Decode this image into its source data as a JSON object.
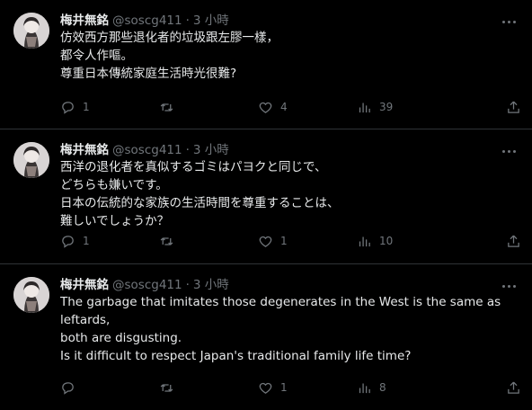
{
  "tweets": [
    {
      "name": "梅井無銘",
      "handle": "@soscg411",
      "sep": "·",
      "time": "3 小時",
      "lines": [
        "仿效西方那些退化者的垃圾跟左膠一樣，",
        "都令人作嘔。",
        "尊重日本傳統家庭生活時光很難?"
      ],
      "replies": "1",
      "retweets": "",
      "likes": "4",
      "views": "39"
    },
    {
      "name": "梅井無銘",
      "handle": "@soscg411",
      "sep": "·",
      "time": "3 小時",
      "lines": [
        "西洋の退化者を真似するゴミはパヨクと同じで、",
        "どちらも嫌いです。",
        "日本の伝統的な家族の生活時間を尊重することは、",
        "難しいでしょうか？"
      ],
      "replies": "1",
      "retweets": "",
      "likes": "1",
      "views": "10"
    },
    {
      "name": "梅井無銘",
      "handle": "@soscg411",
      "sep": "·",
      "time": "3 小時",
      "lines": [
        "The garbage that imitates those degenerates in the West is the same as leftards,",
        "both are disgusting.",
        "Is it difficult to respect Japan's traditional family life time?"
      ],
      "replies": "",
      "retweets": "",
      "likes": "1",
      "views": "8"
    }
  ],
  "icons": {
    "reply": "reply-icon",
    "retweet": "retweet-icon",
    "like": "heart-icon",
    "views": "views-icon",
    "share": "share-icon",
    "more": "more-icon"
  },
  "colors": {
    "background": "#000000",
    "text": "#e7e9ea",
    "muted": "#71767b",
    "divider": "#2f3336"
  }
}
